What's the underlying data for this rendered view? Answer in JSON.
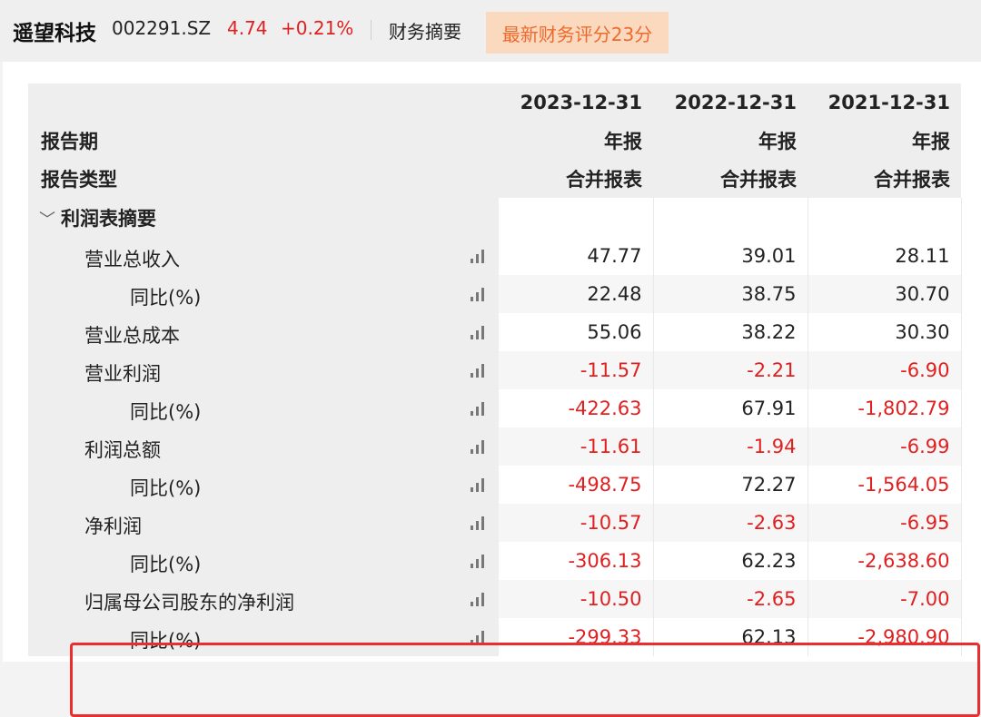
{
  "header": {
    "name": "遥望科技",
    "code": "002291.SZ",
    "price": "4.74",
    "change": "+0.21%",
    "section": "财务摘要",
    "score_label": "最新财务评分23分"
  },
  "table": {
    "period_label": "报告期",
    "type_label": "报告类型",
    "columns": [
      {
        "date": "2023-12-31",
        "period": "年报",
        "type": "合并报表"
      },
      {
        "date": "2022-12-31",
        "period": "年报",
        "type": "合并报表"
      },
      {
        "date": "2021-12-31",
        "period": "年报",
        "type": "合并报表"
      }
    ],
    "section_title": "利润表摘要",
    "rows": [
      {
        "label": "营业总收入",
        "values": [
          "47.77",
          "39.01",
          "28.11"
        ]
      },
      {
        "label": "同比(%)",
        "values": [
          "22.48",
          "38.75",
          "30.70"
        ]
      },
      {
        "label": "营业总成本",
        "values": [
          "55.06",
          "38.22",
          "30.30"
        ]
      },
      {
        "label": "营业利润",
        "values": [
          "-11.57",
          "-2.21",
          "-6.90"
        ]
      },
      {
        "label": "同比(%)",
        "values": [
          "-422.63",
          "67.91",
          "-1,802.79"
        ]
      },
      {
        "label": "利润总额",
        "values": [
          "-11.61",
          "-1.94",
          "-6.99"
        ]
      },
      {
        "label": "同比(%)",
        "values": [
          "-498.75",
          "72.27",
          "-1,564.05"
        ]
      },
      {
        "label": "净利润",
        "values": [
          "-10.57",
          "-2.63",
          "-6.95"
        ]
      },
      {
        "label": "同比(%)",
        "values": [
          "-306.13",
          "62.23",
          "-2,638.60"
        ]
      },
      {
        "label": "归属母公司股东的净利润",
        "values": [
          "-10.50",
          "-2.65",
          "-7.00"
        ]
      },
      {
        "label": "同比(%)",
        "values": [
          "-299.33",
          "62.13",
          "-2,980.90"
        ]
      }
    ]
  },
  "colors": {
    "negative": "#e02020",
    "score_bg": "#fbd9bf",
    "score_text": "#ee6a2c",
    "highlight_border": "#ec2d2d"
  },
  "icons": {
    "chart": "bar-chart-icon",
    "collapse": "chevron-down-icon"
  }
}
